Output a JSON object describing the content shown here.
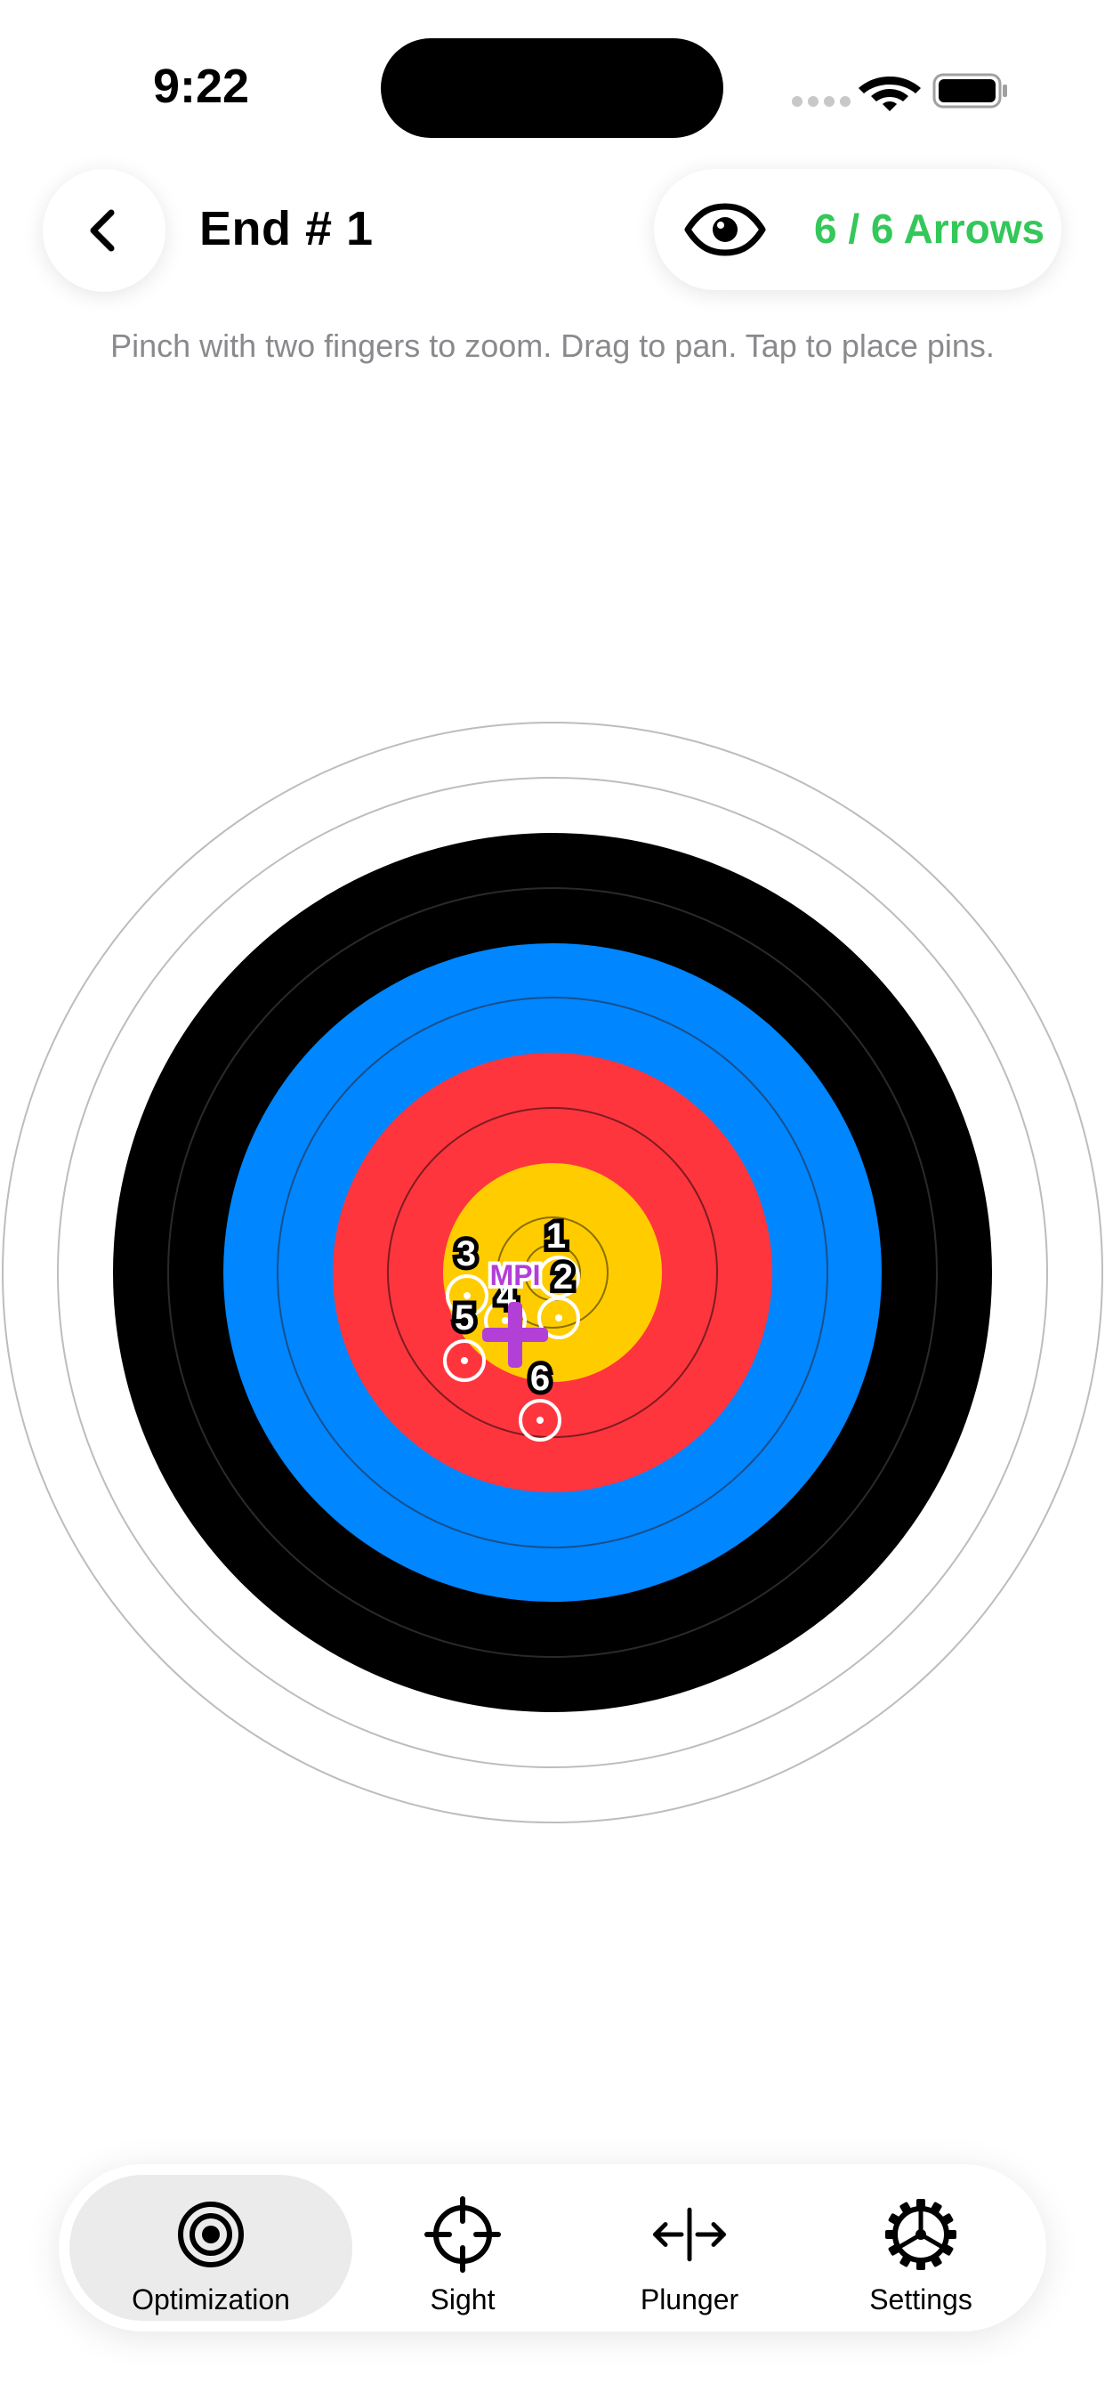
{
  "status_bar": {
    "time": "9:22"
  },
  "header": {
    "back_icon": "chevron-left-icon",
    "title": "End # 1",
    "visibility_icon": "eye-icon",
    "arrow_count": "6 / 6 Arrows",
    "arrow_count_color": "#34c759"
  },
  "hint": "Pinch with two fingers to zoom. Drag to pan. Tap to place pins.",
  "target": {
    "ring_colors": {
      "white": "#ffffff",
      "black": "#000000",
      "blue": "#0086ff",
      "red": "#ff353e",
      "gold": "#ffcc00"
    },
    "arrows": [
      {
        "label": "1"
      },
      {
        "label": "2"
      },
      {
        "label": "3"
      },
      {
        "label": "4"
      },
      {
        "label": "5"
      },
      {
        "label": "6"
      }
    ],
    "mpi": {
      "label": "MPI",
      "color": "#b23fd6"
    }
  },
  "tabs": [
    {
      "label": "Optimization",
      "icon": "target-icon",
      "active": true
    },
    {
      "label": "Sight",
      "icon": "crosshair-icon",
      "active": false
    },
    {
      "label": "Plunger",
      "icon": "plunger-arrows-icon",
      "active": false
    },
    {
      "label": "Settings",
      "icon": "gear-icon",
      "active": false
    }
  ]
}
